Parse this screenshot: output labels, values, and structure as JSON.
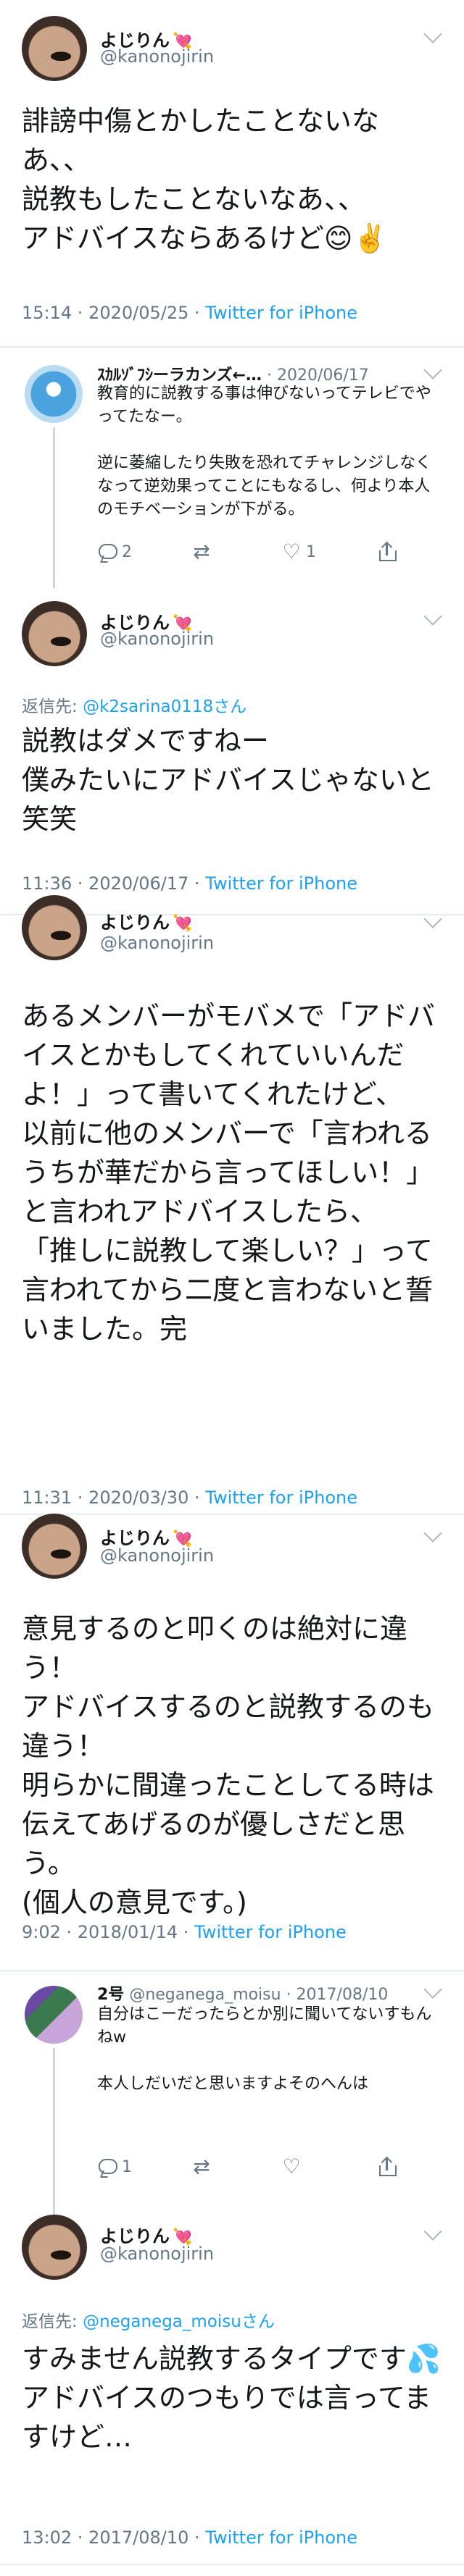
{
  "colors": {
    "link": "#1da1f2",
    "muted": "#657786",
    "heart": "#e0245e",
    "divider": "#e6ecf0"
  },
  "tweets": [
    {
      "name": "よじりん",
      "heart": "💘",
      "handle": "@kanonojirin",
      "text": "誹謗中傷とかしたことないなあ、、\n説教もしたことないなあ、、\nアドバイスならあるけど😊✌️",
      "time": "15:14 · 2020/05/25 · ",
      "via": "Twitter for iPhone"
    },
    {
      "name": "よじりん",
      "heart": "💘",
      "handle": "@kanonojirin",
      "reply_prefix": "返信先: ",
      "reply_mention": "@k2sarina0118さん",
      "text": "説教はダメですねー\n僕みたいにアドバイスじゃないと笑笑",
      "time": "11:36 · 2020/06/17 · ",
      "via": "Twitter for iPhone"
    },
    {
      "name": "よじりん",
      "heart": "💘",
      "handle": "@kanonojirin",
      "text": "あるメンバーがモバメで「アドバイスとかもしてくれていいんだよ！」って書いてくれたけど、\n以前に他のメンバーで「言われるうちが華だから言ってほしい！」と言われアドバイスしたら、\n「推しに説教して楽しい？」って言われてから二度と言わないと誓いました。完",
      "time": "11:31 · 2020/03/30 · ",
      "via": "Twitter for iPhone"
    },
    {
      "name": "よじりん",
      "heart": "💘",
      "handle": "@kanonojirin",
      "text": "意見するのと叩くのは絶対に違う！\nアドバイスするのと説教するのも違う！\n明らかに間違ったことしてる時は伝えてあげるのが優しさだと思う。\n(個人の意見です。)",
      "time": "9:02 · 2018/01/14 · ",
      "via": "Twitter for iPhone"
    },
    {
      "name": "よじりん",
      "heart": "💘",
      "handle": "@kanonojirin",
      "reply_prefix": "返信先: ",
      "reply_mention": "@neganega_moisuさん",
      "text": "すみません説教するタイプです💦\nアドバイスのつもりでは言ってますけど…",
      "time": "13:02 · 2017/08/10 · ",
      "via": "Twitter for iPhone"
    }
  ],
  "quoted": [
    {
      "name": "ｽｶﾙｿﾞﾌｼーラカンズ←…",
      "date": "· 2020/06/17",
      "text": "教育的に説教する事は伸びないってテレビでやってたなー。\n\n逆に萎縮したり失敗を恐れてチャレンジしなくなって逆効果ってことにもなるし、何より本人のモチベーションが下がる。",
      "reply_count": "2",
      "retweet_count": "",
      "like_count": "1"
    },
    {
      "name": "2号",
      "handle_date": "@neganega_moisu · 2017/08/10",
      "text": "自分はこーだったらとか別に聞いてないすもんねw\n\n本人しだいだと思いますよそのへんは",
      "reply_count": "1",
      "retweet_count": "",
      "like_count": ""
    }
  ]
}
